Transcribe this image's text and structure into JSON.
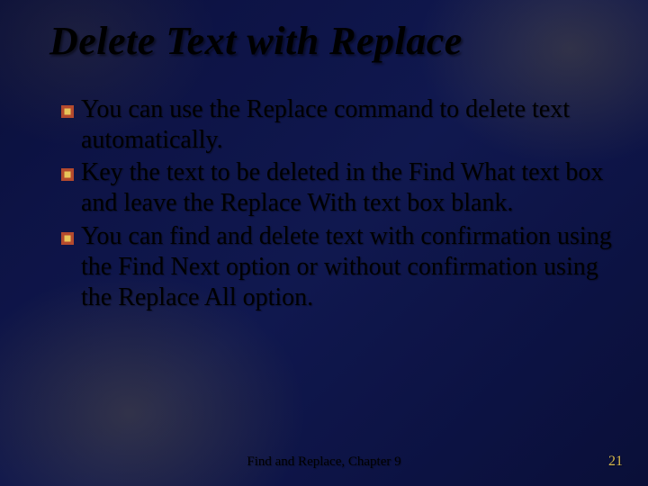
{
  "slide": {
    "title": "Delete Text with Replace",
    "bullets": [
      "You can use the Replace command to delete text automatically.",
      "Key the text to be deleted in the Find What text box and leave the Replace With text box blank.",
      "You can find and delete text with confirmation using the Find Next option or without confirmation using the Replace All option."
    ],
    "footer": "Find and Replace, Chapter 9",
    "page_number": "21"
  },
  "colors": {
    "bullet_outer": "#b44a2e",
    "bullet_inner": "#e8c55a"
  }
}
